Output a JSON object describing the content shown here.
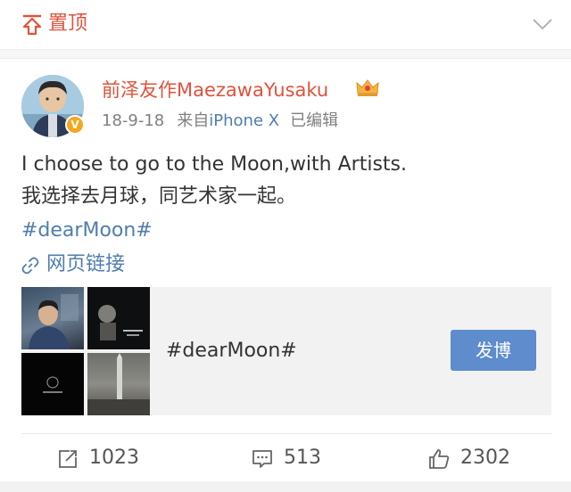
{
  "pin_bar": {
    "label": "置顶",
    "accent_color": "#e0523a",
    "pin_icon": "pin-top-icon",
    "collapse_icon": "chevron-down-icon"
  },
  "post": {
    "author": {
      "name": "前泽友作MaezawaYusaku",
      "avatar": "user-avatar",
      "verified_icon": "verified-v-icon",
      "verified_glyph": "V",
      "member_icon": "crown-icon"
    },
    "meta": {
      "date": "18-9-18",
      "source_prefix": "来自",
      "device": "iPhone X",
      "edited": "已编辑"
    },
    "text_lines": [
      "I choose to go to the Moon,with Artists.",
      "我选择去月球，同艺术家一起。"
    ],
    "hashtag": "#dearMoon#",
    "web_link": {
      "icon": "link-icon",
      "label": "网页链接"
    },
    "card": {
      "title": "#dearMoon#",
      "button_label": "发博",
      "button_color": "#5e8ccc"
    },
    "actions": {
      "repost_icon": "repost-icon",
      "repost_count": "1023",
      "comment_icon": "comment-icon",
      "comment_count": "513",
      "like_icon": "thumbs-up-icon",
      "like_count": "2302"
    },
    "link_color": "#507daf"
  }
}
